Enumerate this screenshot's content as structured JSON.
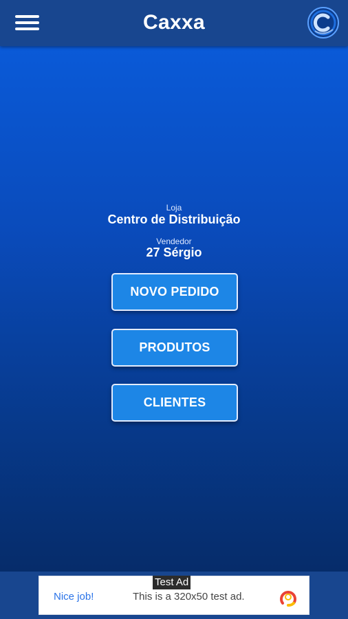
{
  "header": {
    "title": "Caxxa",
    "menu_icon": "hamburger-menu-icon",
    "logo_icon": "caxxa-logo-icon"
  },
  "store": {
    "caption": "Loja",
    "value": "Centro de Distribuição"
  },
  "seller": {
    "caption": "Vendedor",
    "value": "27 Sérgio"
  },
  "buttons": {
    "new_order": "NOVO PEDIDO",
    "products": "PRODUTOS",
    "clients": "CLIENTES"
  },
  "ad": {
    "tag": "Test Ad",
    "nice": "Nice job!",
    "text": "This is a 320x50 test ad.",
    "icon": "ad-choices-icon"
  },
  "colors": {
    "appbar": "#18468f",
    "button": "#1d86e6",
    "gradient_top": "#0a5ad8",
    "gradient_bottom": "#062c6a"
  }
}
